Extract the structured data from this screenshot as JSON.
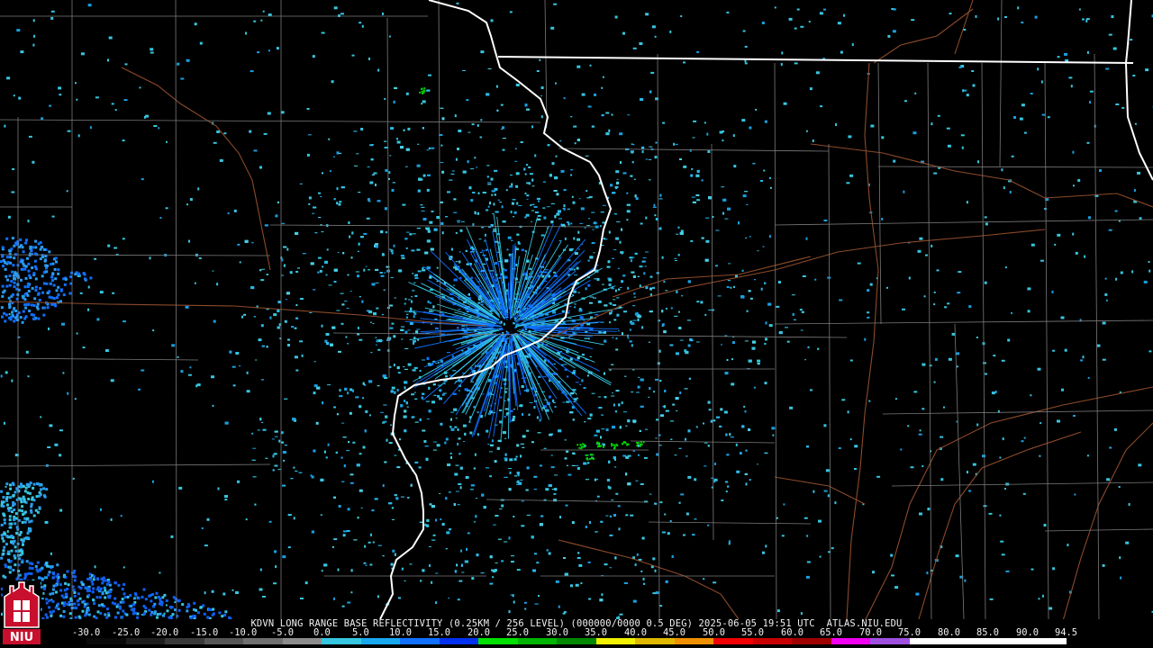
{
  "caption": "KDVN LONG RANGE BASE REFLECTIVITY (0.25KM / 256 LEVEL) (000000/0000 0.5 DEG) 2025-06-05 19:51 UTC  ATLAS.NIU.EDU",
  "scale": {
    "labels": [
      "-30.0",
      "-25.0",
      "-20.0",
      "-15.0",
      "-10.0",
      "-5.0",
      "0.0",
      "5.0",
      "10.0",
      "15.0",
      "20.0",
      "25.0",
      "30.0",
      "35.0",
      "40.0",
      "45.0",
      "50.0",
      "55.0",
      "60.0",
      "65.0",
      "70.0",
      "75.0",
      "80.0",
      "85.0",
      "90.0",
      "94.5"
    ],
    "min": -30.0,
    "max": 94.5,
    "colors": [
      "#0a0a0a",
      "#1e1e1e",
      "#3a3a3a",
      "#565656",
      "#707070",
      "#8c8c8c",
      "#36c6e0",
      "#18a8f0",
      "#1070ff",
      "#0030f0",
      "#00e000",
      "#00b400",
      "#008800",
      "#f0f000",
      "#e0b800",
      "#f09000",
      "#f00000",
      "#c80000",
      "#a00000",
      "#f000f0",
      "#a050e0",
      "#ffffff",
      "#ffffff",
      "#ffffff",
      "#ffffff"
    ]
  },
  "logo": {
    "text": "NIU",
    "colors": {
      "red": "#c8102e",
      "white": "#ffffff"
    }
  },
  "map_colors": {
    "background": "#000000",
    "county_lines": "#7a7a7a",
    "state_lines": "#ffffff",
    "highways": "#8c4a2a",
    "echo_weak": "#36c6e0",
    "echo_medium": "#1070ff",
    "echo_strong": "#00e000"
  }
}
